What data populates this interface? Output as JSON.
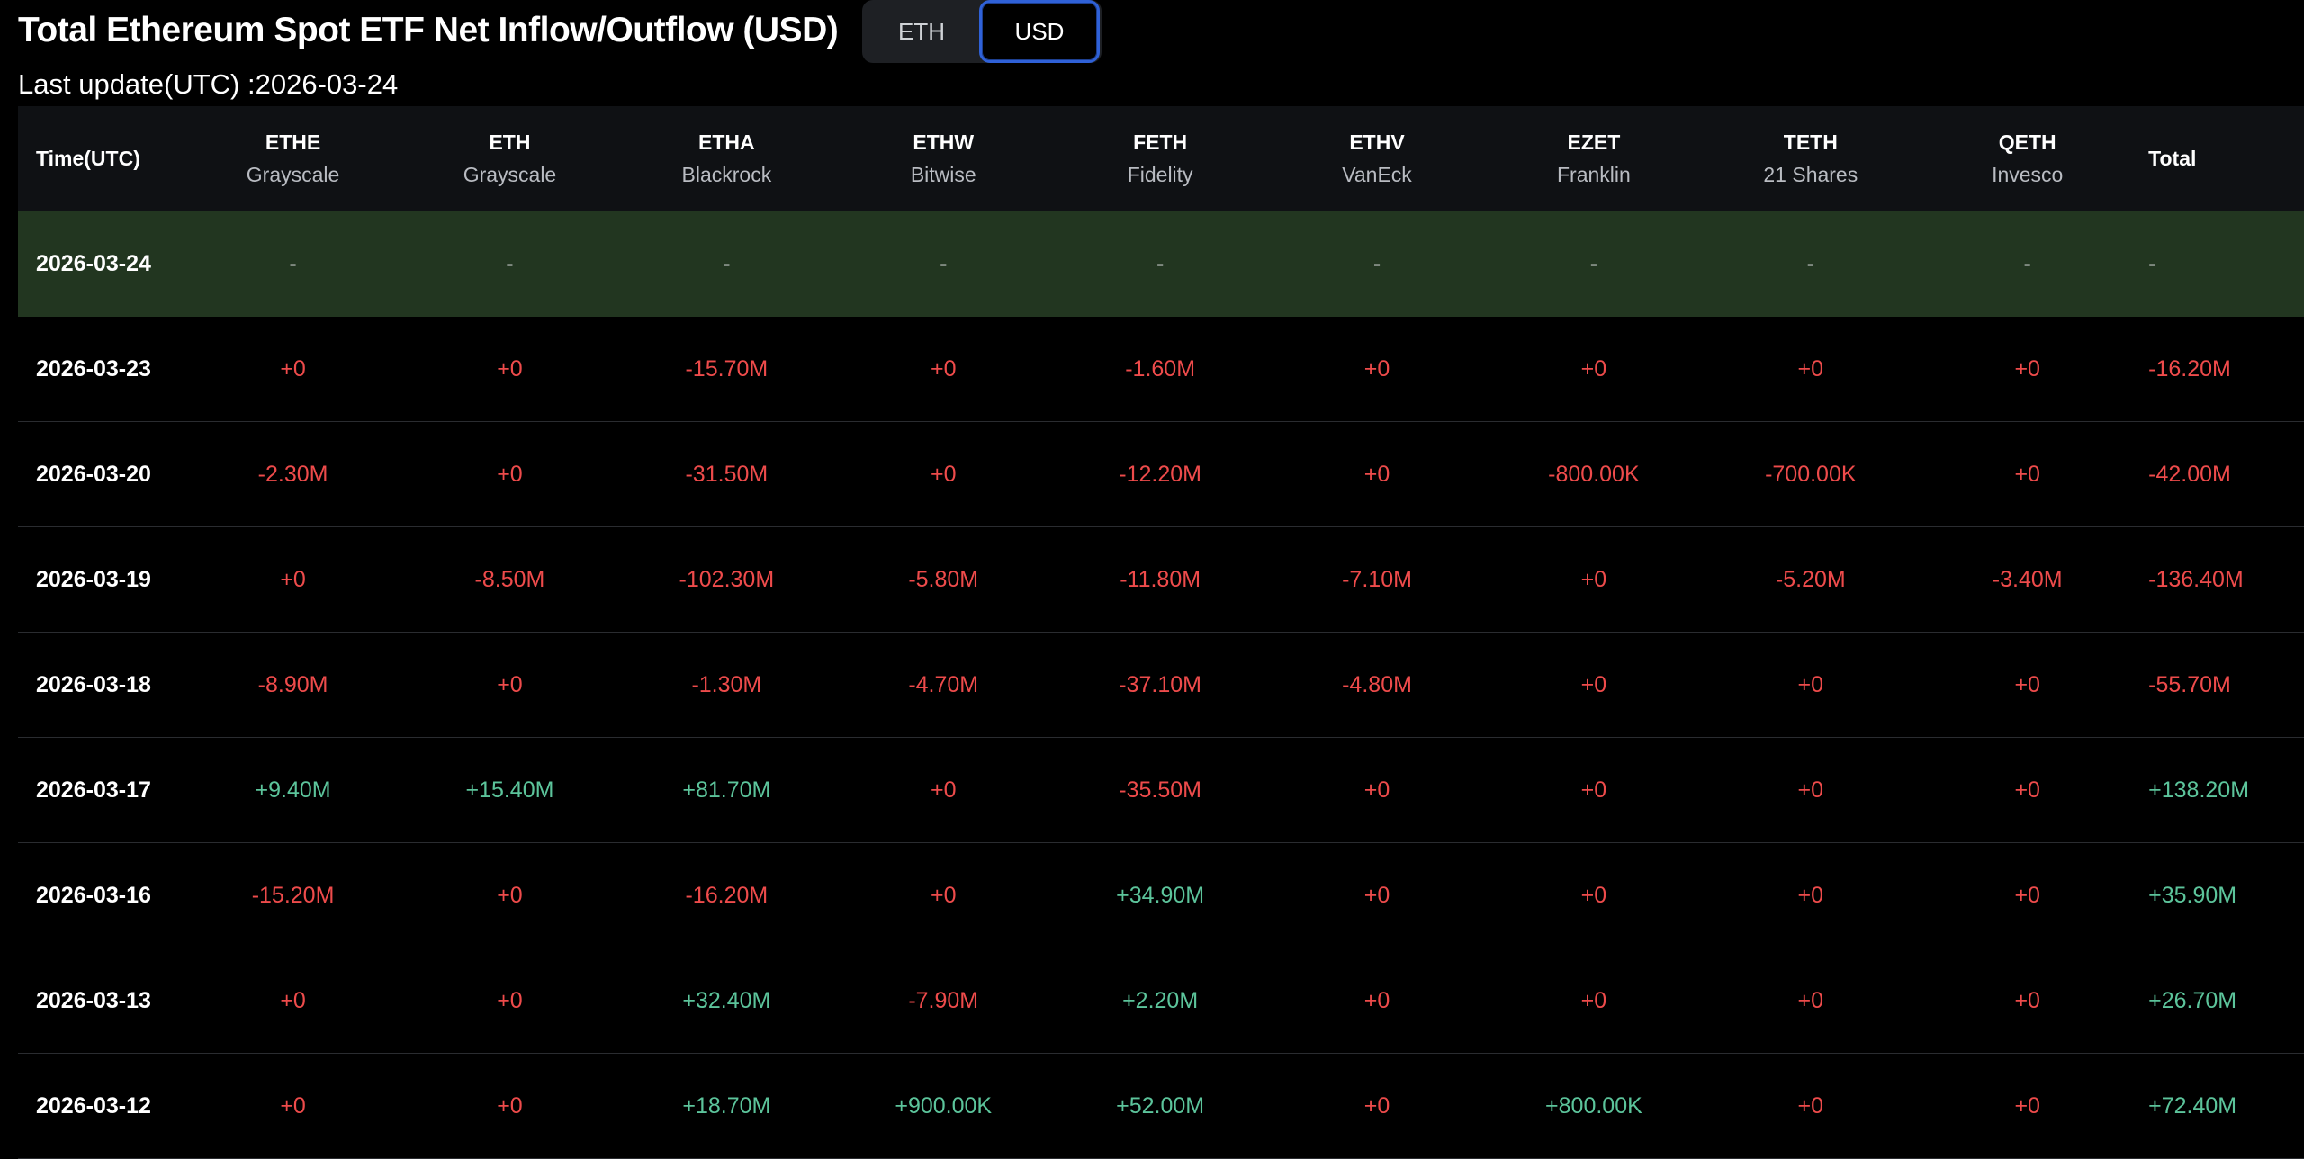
{
  "header": {
    "title": "Total Ethereum Spot ETF Net Inflow/Outflow (USD)",
    "toggle": {
      "eth_label": "ETH",
      "usd_label": "USD",
      "selected": "USD"
    },
    "last_update": "Last update(UTC) :2026-03-24"
  },
  "colors": {
    "negative": "#ee4b4b",
    "positive": "#5cc49b",
    "highlight_row": "#223620",
    "toggle_active_border": "#2f61d8"
  },
  "table": {
    "first_header": "Time(UTC)",
    "total_header": "Total",
    "columns": [
      {
        "symbol": "ETHE",
        "issuer": "Grayscale"
      },
      {
        "symbol": "ETH",
        "issuer": "Grayscale"
      },
      {
        "symbol": "ETHA",
        "issuer": "Blackrock"
      },
      {
        "symbol": "ETHW",
        "issuer": "Bitwise"
      },
      {
        "symbol": "FETH",
        "issuer": "Fidelity"
      },
      {
        "symbol": "ETHV",
        "issuer": "VanEck"
      },
      {
        "symbol": "EZET",
        "issuer": "Franklin"
      },
      {
        "symbol": "TETH",
        "issuer": "21 Shares"
      },
      {
        "symbol": "QETH",
        "issuer": "Invesco"
      }
    ],
    "rows": [
      {
        "date": "2026-03-24",
        "highlight": true,
        "values": [
          "-",
          "-",
          "-",
          "-",
          "-",
          "-",
          "-",
          "-",
          "-"
        ],
        "total": "-"
      },
      {
        "date": "2026-03-23",
        "values": [
          "+0",
          "+0",
          "-15.70M",
          "+0",
          "-1.60M",
          "+0",
          "+0",
          "+0",
          "+0"
        ],
        "total": "-16.20M"
      },
      {
        "date": "2026-03-20",
        "values": [
          "-2.30M",
          "+0",
          "-31.50M",
          "+0",
          "-12.20M",
          "+0",
          "-800.00K",
          "-700.00K",
          "+0"
        ],
        "total": "-42.00M"
      },
      {
        "date": "2026-03-19",
        "values": [
          "+0",
          "-8.50M",
          "-102.30M",
          "-5.80M",
          "-11.80M",
          "-7.10M",
          "+0",
          "-5.20M",
          "-3.40M"
        ],
        "total": "-136.40M"
      },
      {
        "date": "2026-03-18",
        "values": [
          "-8.90M",
          "+0",
          "-1.30M",
          "-4.70M",
          "-37.10M",
          "-4.80M",
          "+0",
          "+0",
          "+0"
        ],
        "total": "-55.70M"
      },
      {
        "date": "2026-03-17",
        "values": [
          "+9.40M",
          "+15.40M",
          "+81.70M",
          "+0",
          "-35.50M",
          "+0",
          "+0",
          "+0",
          "+0"
        ],
        "total": "+138.20M"
      },
      {
        "date": "2026-03-16",
        "values": [
          "-15.20M",
          "+0",
          "-16.20M",
          "+0",
          "+34.90M",
          "+0",
          "+0",
          "+0",
          "+0"
        ],
        "total": "+35.90M"
      },
      {
        "date": "2026-03-13",
        "values": [
          "+0",
          "+0",
          "+32.40M",
          "-7.90M",
          "+2.20M",
          "+0",
          "+0",
          "+0",
          "+0"
        ],
        "total": "+26.70M"
      },
      {
        "date": "2026-03-12",
        "values": [
          "+0",
          "+0",
          "+18.70M",
          "+900.00K",
          "+52.00M",
          "+0",
          "+800.00K",
          "+0",
          "+0"
        ],
        "total": "+72.40M"
      }
    ]
  }
}
